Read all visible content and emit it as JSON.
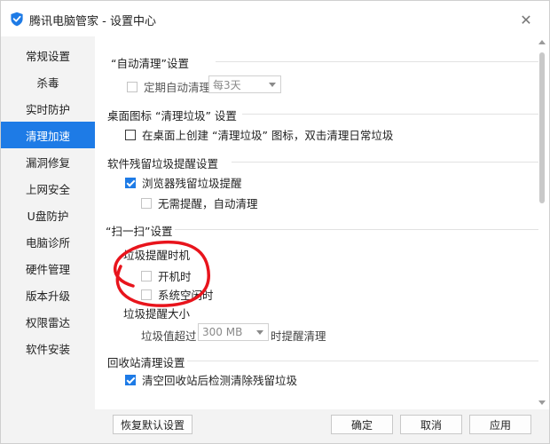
{
  "window": {
    "title": "腾讯电脑管家 - 设置中心",
    "close_glyph": "✕"
  },
  "sidebar": {
    "items": [
      {
        "label": "常规设置",
        "active": false
      },
      {
        "label": "杀毒",
        "active": false
      },
      {
        "label": "实时防护",
        "active": false
      },
      {
        "label": "清理加速",
        "active": true
      },
      {
        "label": "漏洞修复",
        "active": false
      },
      {
        "label": "上网安全",
        "active": false
      },
      {
        "label": "U盘防护",
        "active": false
      },
      {
        "label": "电脑诊所",
        "active": false
      },
      {
        "label": "硬件管理",
        "active": false
      },
      {
        "label": "版本升级",
        "active": false
      },
      {
        "label": "权限雷达",
        "active": false
      },
      {
        "label": "软件安装",
        "active": false
      }
    ]
  },
  "content": {
    "auto_clean": {
      "title": "“自动清理”设置",
      "option_label": "定期自动清理",
      "option_checked": false,
      "interval_value": "每3天"
    },
    "desktop_icon": {
      "title": "桌面图标 “清理垃圾” 设置",
      "option_label": "在桌面上创建 “清理垃圾” 图标，双击清理日常垃圾",
      "option_checked": false
    },
    "residual": {
      "title": "软件残留垃圾提醒设置",
      "browser_label": "浏览器残留垃圾提醒",
      "browser_checked": true,
      "no_prompt_label": "无需提醒，自动清理",
      "no_prompt_checked": false
    },
    "scan": {
      "title": "“扫一扫”设置",
      "timing_title": "垃圾提醒时机",
      "startup_label": "开机时",
      "startup_checked": false,
      "idle_label": "系统空闲时",
      "idle_checked": false,
      "size_title": "垃圾提醒大小",
      "size_prefix": "垃圾值超过",
      "size_value": "300 MB",
      "size_suffix": "时提醒清理"
    },
    "recycle": {
      "title": "回收站清理设置",
      "option_label": "清空回收站后检测清除残留垃圾",
      "option_checked": true
    }
  },
  "footer": {
    "restore_label": "恢复默认设置",
    "ok_label": "确定",
    "cancel_label": "取消",
    "apply_label": "应用"
  },
  "colors": {
    "accent": "#1e7be6",
    "annotation_red": "#e8141c"
  },
  "icons": {
    "app": "tencent-shield-icon",
    "close": "close-icon"
  }
}
